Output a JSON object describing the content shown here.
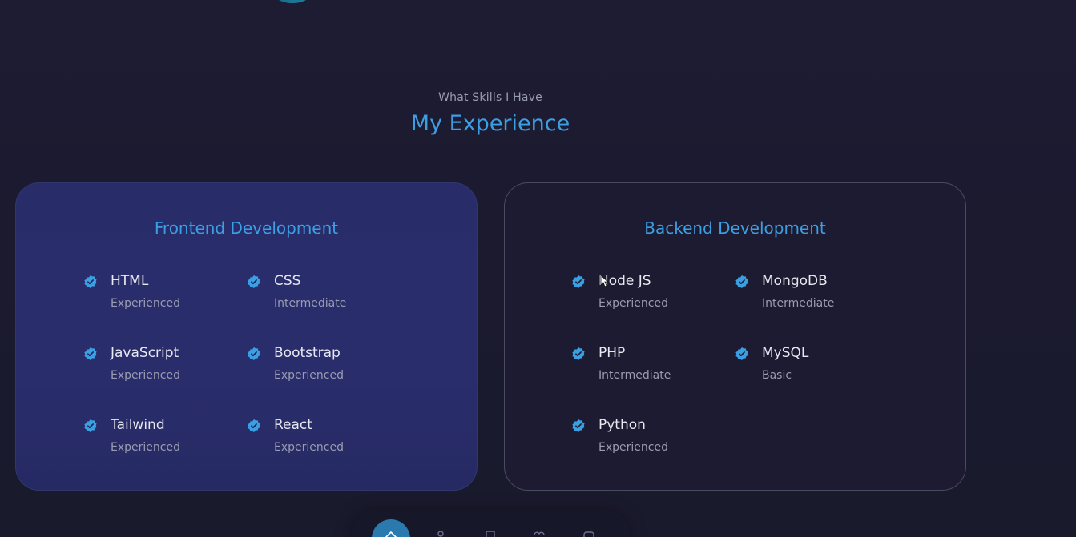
{
  "header": {
    "subtitle": "What Skills I Have",
    "title": "My Experience"
  },
  "frontend": {
    "title": "Frontend Development",
    "skills": [
      {
        "name": "HTML",
        "level": "Experienced"
      },
      {
        "name": "CSS",
        "level": "Intermediate"
      },
      {
        "name": "JavaScript",
        "level": "Experienced"
      },
      {
        "name": "Bootstrap",
        "level": "Experienced"
      },
      {
        "name": "Tailwind",
        "level": "Experienced"
      },
      {
        "name": "React",
        "level": "Experienced"
      }
    ]
  },
  "backend": {
    "title": "Backend Development",
    "skills": [
      {
        "name": "Node JS",
        "level": "Experienced"
      },
      {
        "name": "MongoDB",
        "level": "Intermediate"
      },
      {
        "name": "PHP",
        "level": "Intermediate"
      },
      {
        "name": "MySQL",
        "level": "Basic"
      },
      {
        "name": "Python",
        "level": "Experienced"
      }
    ]
  },
  "nav": {
    "icons": [
      "home-icon",
      "user-icon",
      "book-icon",
      "briefcase-icon",
      "chat-icon"
    ]
  },
  "colors": {
    "accent": "#3b9fe4",
    "check": "#3b9fe4",
    "frontend_card": "#2a2d6c",
    "background": "#1b1a2f"
  }
}
